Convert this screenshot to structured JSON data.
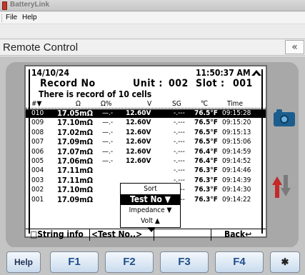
{
  "window": {
    "title": "BatteryLink"
  },
  "menu": {
    "file": "File",
    "help": "Help"
  },
  "remote": {
    "title": "Remote Control",
    "collapse_icon": "«"
  },
  "lcd": {
    "date": "14/10/24",
    "time": "11:50:37 AM",
    "record_label": "Record No",
    "unit_label": "Unit :",
    "unit_value": "002",
    "slot_label": "Slot :",
    "slot_value": "001",
    "info": "There is record of 10 cells",
    "columns": [
      "#▼",
      "Ω",
      "Ω%",
      "V",
      "SG",
      "℃",
      "Time"
    ],
    "rows": [
      {
        "no": "010",
        "ohm": "17.05mΩ",
        "pct": "—.-",
        "v": "12.60V",
        "sg": "-.---",
        "temp": "76.5°F",
        "time": "09:15:28",
        "selected": true
      },
      {
        "no": "009",
        "ohm": "17.10mΩ",
        "pct": "—.-",
        "v": "12.60V",
        "sg": "-.---",
        "temp": "76.5°F",
        "time": "09:15:20"
      },
      {
        "no": "008",
        "ohm": "17.02mΩ",
        "pct": "—.-",
        "v": "12.60V",
        "sg": "-.---",
        "temp": "76.5°F",
        "time": "09:15:13"
      },
      {
        "no": "007",
        "ohm": "17.09mΩ",
        "pct": "—.-",
        "v": "12.60V",
        "sg": "-.---",
        "temp": "76.5°F",
        "time": "09:15:06"
      },
      {
        "no": "006",
        "ohm": "17.07mΩ",
        "pct": "—.-",
        "v": "12.60V",
        "sg": "-.---",
        "temp": "76.4°F",
        "time": "09:14:59"
      },
      {
        "no": "005",
        "ohm": "17.06mΩ",
        "pct": "—.-",
        "v": "12.60V",
        "sg": "-.---",
        "temp": "76.4°F",
        "time": "09:14:52"
      },
      {
        "no": "004",
        "ohm": "17.11mΩ",
        "pct": "",
        "v": "",
        "sg": "-.---",
        "temp": "76.3°F",
        "time": "09:14:46"
      },
      {
        "no": "003",
        "ohm": "17.11mΩ",
        "pct": "",
        "v": "",
        "sg": "-.---",
        "temp": "76.3°F",
        "time": "09:14:39"
      },
      {
        "no": "002",
        "ohm": "17.10mΩ",
        "pct": "",
        "v": "",
        "sg": "-.---",
        "temp": "76.3°F",
        "time": "09:14:30"
      },
      {
        "no": "001",
        "ohm": "17.09mΩ",
        "pct": "",
        "v": "",
        "sg": "-.---",
        "temp": "76.3°F",
        "time": "09:14:22"
      }
    ],
    "sort_popup": {
      "title": "Sort",
      "option_active": "Test No ▼",
      "option_2": "Impedance ▼",
      "option_3": "Volt ▲"
    },
    "bottom": {
      "string_info": "□String info",
      "test_no": "<Test No..>",
      "back": "Back↩"
    }
  },
  "fkeys": {
    "help": "Help",
    "f1": "F1",
    "f2": "F2",
    "f3": "F3",
    "f4": "F4",
    "last": "✱"
  },
  "colors": {
    "accent": "#1f4e8c",
    "camera": "#1b5e8e",
    "arrow_up": "#c62828",
    "arrow_down": "#7a7a7a"
  }
}
